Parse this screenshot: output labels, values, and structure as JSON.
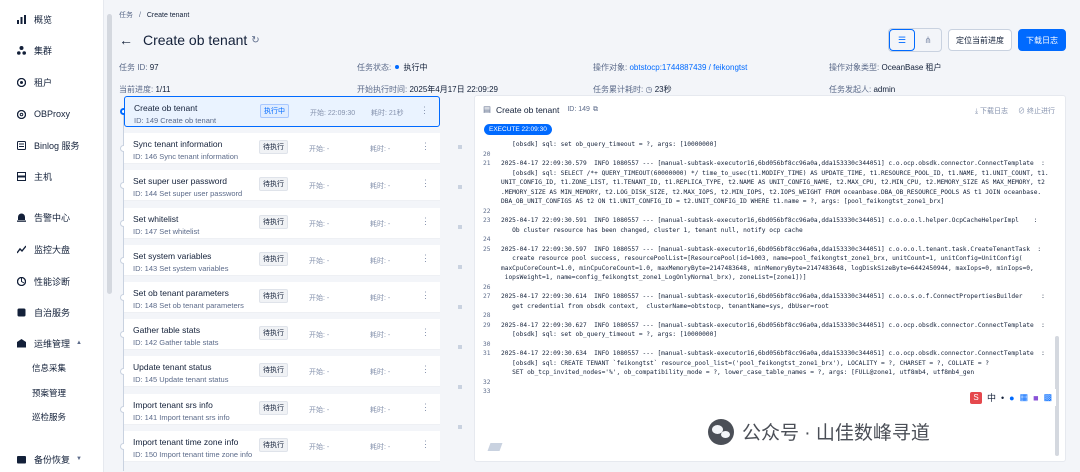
{
  "sidebar": {
    "items": [
      {
        "label": "概览",
        "icon": "bar-chart-icon"
      },
      {
        "label": "集群",
        "icon": "cluster-icon"
      },
      {
        "label": "租户",
        "icon": "tenant-icon"
      },
      {
        "label": "OBProxy",
        "icon": "proxy-icon"
      },
      {
        "label": "Binlog 服务",
        "icon": "binlog-icon"
      },
      {
        "label": "主机",
        "icon": "host-icon"
      },
      {
        "label": "告警中心",
        "icon": "alarm-icon"
      },
      {
        "label": "监控大盘",
        "icon": "monitor-icon"
      },
      {
        "label": "性能诊断",
        "icon": "diagnosis-icon"
      },
      {
        "label": "自治服务",
        "icon": "autonomous-icon"
      },
      {
        "label": "运维管理",
        "icon": "ops-icon"
      },
      {
        "label": "备份恢复",
        "icon": "backup-icon"
      }
    ],
    "sub_items": [
      "信息采集",
      "预案管理",
      "巡检服务"
    ]
  },
  "breadcrumb": {
    "parent": "任务",
    "sep": "/",
    "current": "Create tenant"
  },
  "header": {
    "title": "Create ob tenant",
    "locate_label": "定位当前进度",
    "download_label": "下载日志"
  },
  "meta": {
    "task_id_label": "任务 ID:",
    "task_id": "97",
    "status_label": "任务状态:",
    "status": "执行中",
    "target_label": "操作对象:",
    "target": "obtstocp:1744887439 / feikongtst",
    "target_type_label": "操作对象类型:",
    "target_type": "OceanBase 租户",
    "progress_label": "当前进度:",
    "progress": "1/11",
    "start_label": "开始执行时间:",
    "start": "2025年4月17日 22:09:29",
    "elapsed_label": "任务累计耗时:",
    "elapsed": "23秒",
    "initiator_label": "任务发起人:",
    "initiator": "admin"
  },
  "tasks": [
    {
      "name": "Create ob tenant",
      "sub": "ID: 149  Create ob tenant",
      "status": "执行中",
      "start": "开始: 22:09:30",
      "dur": "耗时: 21秒"
    },
    {
      "name": "Sync tenant information",
      "sub": "ID: 146  Sync tenant information",
      "status": "待执行",
      "start": "开始: -",
      "dur": "耗时: -"
    },
    {
      "name": "Set super user password",
      "sub": "ID: 144  Set super user password",
      "status": "待执行",
      "start": "开始: -",
      "dur": "耗时: -"
    },
    {
      "name": "Set whitelist",
      "sub": "ID: 147  Set whitelist",
      "status": "待执行",
      "start": "开始: -",
      "dur": "耗时: -"
    },
    {
      "name": "Set system variables",
      "sub": "ID: 143  Set system variables",
      "status": "待执行",
      "start": "开始: -",
      "dur": "耗时: -"
    },
    {
      "name": "Set ob tenant parameters",
      "sub": "ID: 148  Set ob tenant parameters",
      "status": "待执行",
      "start": "开始: -",
      "dur": "耗时: -"
    },
    {
      "name": "Gather table stats",
      "sub": "ID: 142  Gather table stats",
      "status": "待执行",
      "start": "开始: -",
      "dur": "耗时: -"
    },
    {
      "name": "Update tenant status",
      "sub": "ID: 145  Update tenant status",
      "status": "待执行",
      "start": "开始: -",
      "dur": "耗时: -"
    },
    {
      "name": "Import tenant srs info",
      "sub": "ID: 141  Import tenant srs info",
      "status": "待执行",
      "start": "开始: -",
      "dur": "耗时: -"
    },
    {
      "name": "Import tenant time zone info",
      "sub": "ID: 150  Import tenant time zone info",
      "status": "待执行",
      "start": "开始: -",
      "dur": "耗时: -"
    }
  ],
  "log": {
    "title": "Create ob tenant",
    "id": "ID: 149",
    "download": "下载日志",
    "stop": "终止进行",
    "exec_tag": "EXECUTE 22:09:30",
    "lines": [
      {
        "n": "",
        "t": "   [obsdk] sql: set ob_query_timeout = ?, args: [10000000]"
      },
      {
        "n": "20",
        "t": ""
      },
      {
        "n": "21",
        "t": "2025-04-17 22:09:30.579  INFO 1080557 --- [manual-subtask-executor16,6bd056bf8cc96a0a,dda153330c344051] c.o.ocp.obsdk.connector.ConnectTemplate  :"
      },
      {
        "n": "",
        "t": "   [obsdk] sql: SELECT /*+ QUERY_TIMEOUT(60000000) */ time_to_usec(t1.MODIFY_TIME) AS UPDATE_TIME, t1.RESOURCE_POOL_ID, t1.NAME, t1.UNIT_COUNT, t1."
      },
      {
        "n": "",
        "t": "UNIT_CONFIG_ID, t1.ZONE_LIST, t1.TENANT_ID, t1.REPLICA_TYPE, t2.NAME AS UNIT_CONFIG_NAME, t2.MAX_CPU, t2.MIN_CPU, t2.MEMORY_SIZE AS MAX_MEMORY, t2"
      },
      {
        "n": "",
        "t": ".MEMORY_SIZE AS MIN_MEMORY, t2.LOG_DISK_SIZE, t2.MAX_IOPS, t2.MIN_IOPS, t2.IOPS_WEIGHT FROM oceanbase.DBA_OB_RESOURCE_POOLS AS t1 JOIN oceanbase."
      },
      {
        "n": "",
        "t": "DBA_OB_UNIT_CONFIGS AS t2 ON t1.UNIT_CONFIG_ID = t2.UNIT_CONFIG_ID WHERE t1.name = ?, args: [pool_feikongtst_zone1_brx]"
      },
      {
        "n": "22",
        "t": ""
      },
      {
        "n": "23",
        "t": "2025-04-17 22:09:30.591  INFO 1080557 --- [manual-subtask-executor16,6bd056bf8cc96a0a,dda153330c344051] c.o.o.o.l.helper.OcpCacheHelperImpl    :"
      },
      {
        "n": "",
        "t": "   Ob cluster resource has been changed, cluster 1, tenant null, notify ocp cache"
      },
      {
        "n": "24",
        "t": ""
      },
      {
        "n": "25",
        "t": "2025-04-17 22:09:30.597  INFO 1080557 --- [manual-subtask-executor16,6bd056bf8cc96a0a,dda153330c344051] c.o.o.o.l.tenant.task.CreateTenantTask  :"
      },
      {
        "n": "",
        "t": "   create resource pool success, resourcePoolList=[ResourcePool(id=1003, name=pool_feikongtst_zone1_brx, unitCount=1, unitConfig=UnitConfig("
      },
      {
        "n": "",
        "t": "maxCpuCoreCount=1.0, minCpuCoreCount=1.0, maxMemoryByte=2147483648, minMemoryByte=2147483648, logDiskSizeByte=6442450944, maxIops=0, minIops=0,"
      },
      {
        "n": "",
        "t": " iopsWeight=1, name=config_feikongtst_zone1_LogOnlyNormal_brx), zoneList=[zone1])]"
      },
      {
        "n": "26",
        "t": ""
      },
      {
        "n": "27",
        "t": "2025-04-17 22:09:30.614  INFO 1080557 --- [manual-subtask-executor16,6bd056bf8cc96a0a,dda153330c344051] c.o.o.s.o.f.ConnectPropertiesBuilder     :"
      },
      {
        "n": "",
        "t": "   get credential from obsdk context,  clusterName=obtstocp, tenantName=sys, dbUser=root"
      },
      {
        "n": "28",
        "t": ""
      },
      {
        "n": "29",
        "t": "2025-04-17 22:09:30.627  INFO 1080557 --- [manual-subtask-executor16,6bd056bf8cc96a0a,dda153330c344051] c.o.ocp.obsdk.connector.ConnectTemplate  :"
      },
      {
        "n": "",
        "t": "   [obsdk] sql: set ob_query_timeout = ?, args: [10000000]"
      },
      {
        "n": "30",
        "t": ""
      },
      {
        "n": "31",
        "t": "2025-04-17 22:09:30.634  INFO 1080557 --- [manual-subtask-executor16,6bd056bf8cc96a0a,dda153330c344051] c.o.ocp.obsdk.connector.ConnectTemplate  :"
      },
      {
        "n": "",
        "t": "   [obsdk] sql: CREATE TENANT `feikongtst` resource_pool_list=('pool_feikongtst_zone1_brx'), LOCALITY = ?, CHARSET = ?, COLLATE = ?"
      },
      {
        "n": "",
        "t": "   SET ob_tcp_invited_nodes='%', ob_compatibility_mode = ?, lower_case_table_names = ?, args: [FULL@zone1, utf8mb4, utf8mb4_gen"
      },
      {
        "n": "32",
        "t": ""
      },
      {
        "n": "33",
        "t": ""
      }
    ]
  },
  "watermark": {
    "text": "公众号 · 山佳数峰寻道"
  },
  "ime": {
    "logo": "S",
    "lang": "中",
    "punct": "•"
  }
}
